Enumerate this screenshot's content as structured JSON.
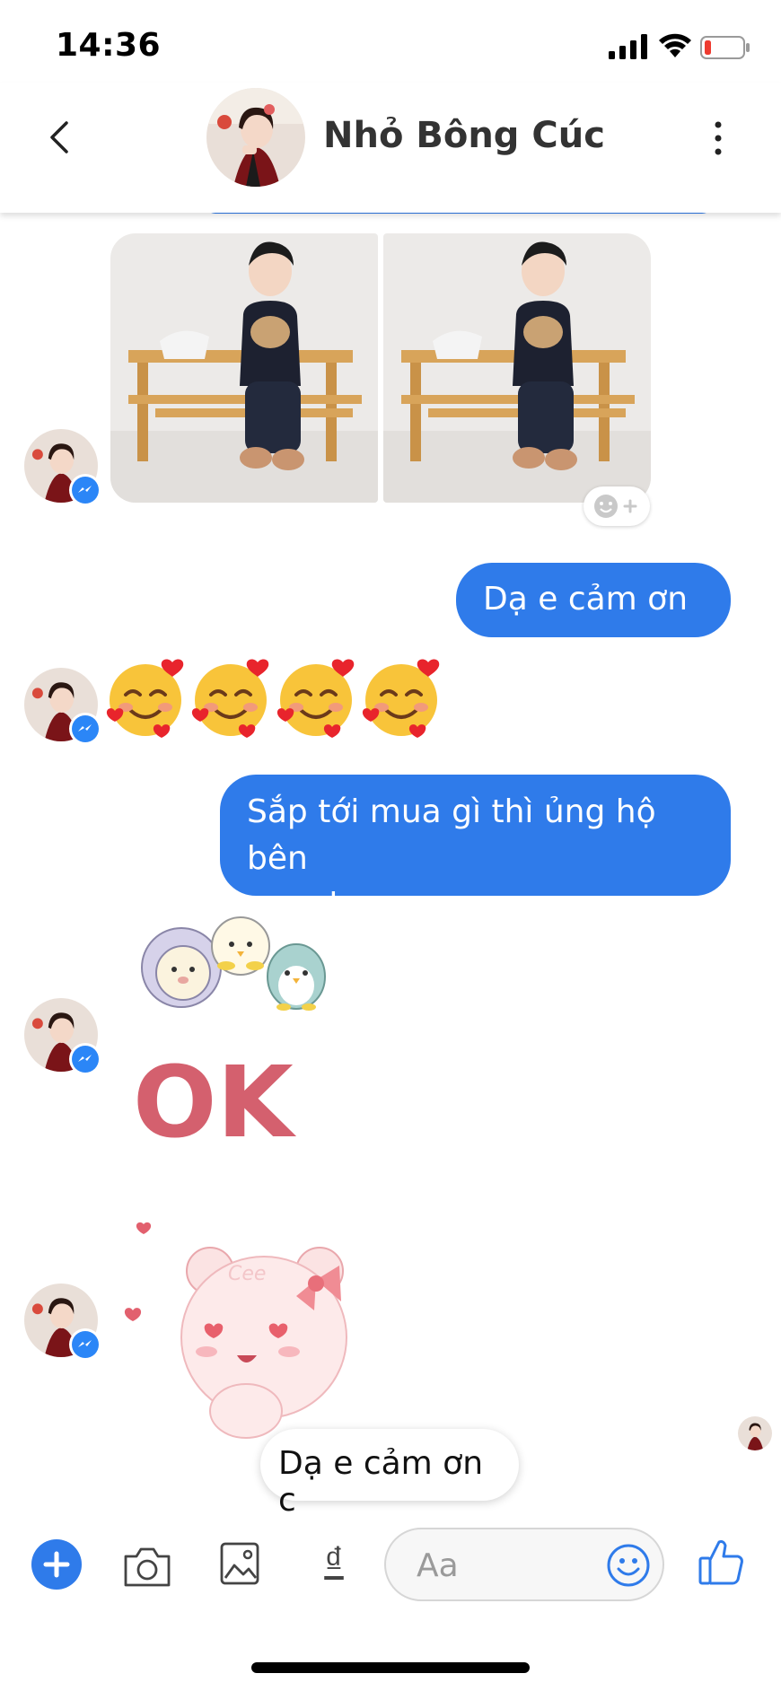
{
  "status_bar": {
    "time": "14:36"
  },
  "header": {
    "contact_name": "Nhỏ Bông Cúc"
  },
  "messages": [
    {
      "type": "photos",
      "sender": "contact",
      "count": 2
    },
    {
      "type": "text",
      "sender": "me",
      "text": "Dạ e cảm ơn c"
    },
    {
      "type": "emoji",
      "sender": "contact",
      "emoji": [
        "🥰",
        "🥰",
        "🥰",
        "🥰"
      ]
    },
    {
      "type": "text",
      "sender": "me",
      "text_line1": "Sắp tới mua gì thì ủng hộ bên",
      "text_line2": "em nha c"
    },
    {
      "type": "sticker",
      "sender": "contact",
      "sticker_text": "OK"
    },
    {
      "type": "sticker",
      "sender": "contact",
      "sticker_text": "Cee"
    }
  ],
  "suggested_reply": "Dạ e cảm ơn c",
  "composer": {
    "placeholder": "Aa",
    "money_symbol": "₫"
  },
  "colors": {
    "accent": "#2f7bea",
    "messenger_badge": "#2b86f7"
  },
  "icons": [
    "back-icon",
    "more-icon",
    "messenger-badge-icon",
    "add-reaction-icon",
    "plus-icon",
    "camera-icon",
    "gallery-icon",
    "emoji-icon",
    "thumbs-up-icon"
  ]
}
